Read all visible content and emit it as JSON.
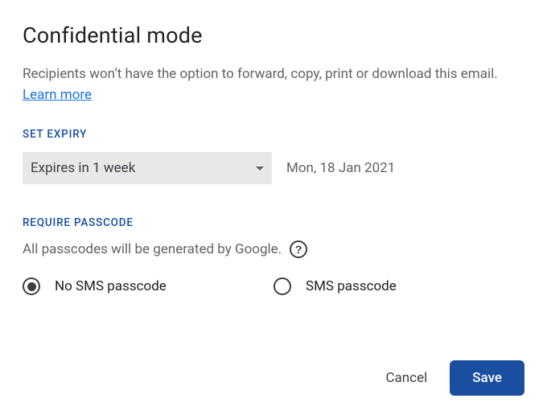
{
  "title": "Confidential mode",
  "description": "Recipients won’t have the option to forward, copy, print or download this email. ",
  "learn_more": "Learn more",
  "expiry": {
    "label": "SET EXPIRY",
    "selected": "Expires in 1 week",
    "date": "Mon, 18 Jan 2021"
  },
  "passcode": {
    "label": "REQUIRE PASSCODE",
    "note": "All passcodes will be generated by Google.",
    "options": {
      "no_sms": "No SMS passcode",
      "sms": "SMS passcode"
    },
    "selected": "no_sms"
  },
  "actions": {
    "cancel": "Cancel",
    "save": "Save"
  }
}
